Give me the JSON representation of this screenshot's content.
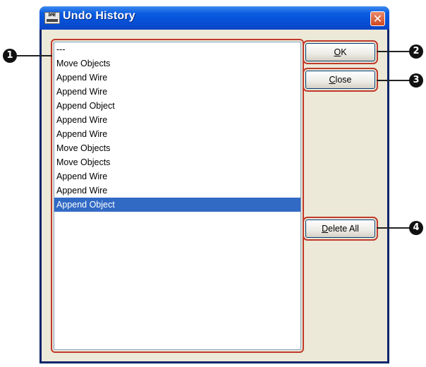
{
  "window": {
    "title": "Undo History",
    "icon_label": "DME",
    "icon": "app-icon",
    "close_icon": "close-icon"
  },
  "list": {
    "items": [
      "---",
      "Move Objects",
      "Append Wire",
      "Append Wire",
      "Append Object",
      "Append Wire",
      "Append Wire",
      "Move Objects",
      "Move Objects",
      "Append Wire",
      "Append Wire",
      "Append Object"
    ],
    "selected_index": 11
  },
  "buttons": {
    "ok": {
      "mnemonic": "O",
      "rest": "K"
    },
    "close": {
      "mnemonic": "C",
      "rest": "lose"
    },
    "delete_all": {
      "mnemonic": "D",
      "rest": "elete All"
    }
  },
  "callouts": [
    "1",
    "2",
    "3",
    "4"
  ],
  "colors": {
    "title_bar": "#0652d8",
    "selection": "#316ac5",
    "highlight_outline": "#c0392b",
    "dialog_bg": "#ece9d8"
  }
}
